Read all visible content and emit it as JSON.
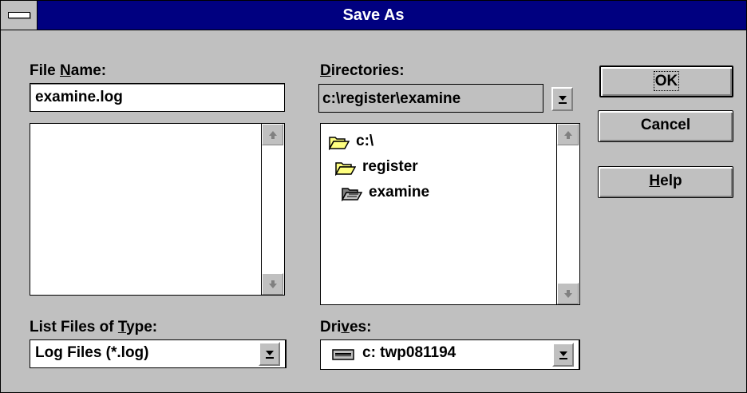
{
  "window": {
    "title": "Save As"
  },
  "file_name": {
    "label_pre": "File ",
    "label_key": "N",
    "label_post": "ame:",
    "value": "examine.log",
    "files": []
  },
  "directories": {
    "label_key": "D",
    "label_post": "irectories:",
    "current": "c:\\register\\examine",
    "items": [
      {
        "name": "c:\\",
        "icon": "open-folder-icon"
      },
      {
        "name": "register",
        "icon": "open-folder-icon"
      },
      {
        "name": "examine",
        "icon": "open-folder-selected-icon"
      }
    ]
  },
  "file_type": {
    "label_pre": "List Files of ",
    "label_key": "T",
    "label_post": "ype:",
    "value": "Log Files (*.log)"
  },
  "drives": {
    "label_pre": "Dri",
    "label_key": "v",
    "label_post": "es:",
    "value": "c: twp081194",
    "icon": "drive-icon"
  },
  "buttons": {
    "ok": "OK",
    "cancel": "Cancel",
    "help_key": "H",
    "help_post": "elp"
  },
  "colors": {
    "titlebar": "#000080",
    "face": "#c0c0c0",
    "folder": "#ffff80"
  }
}
